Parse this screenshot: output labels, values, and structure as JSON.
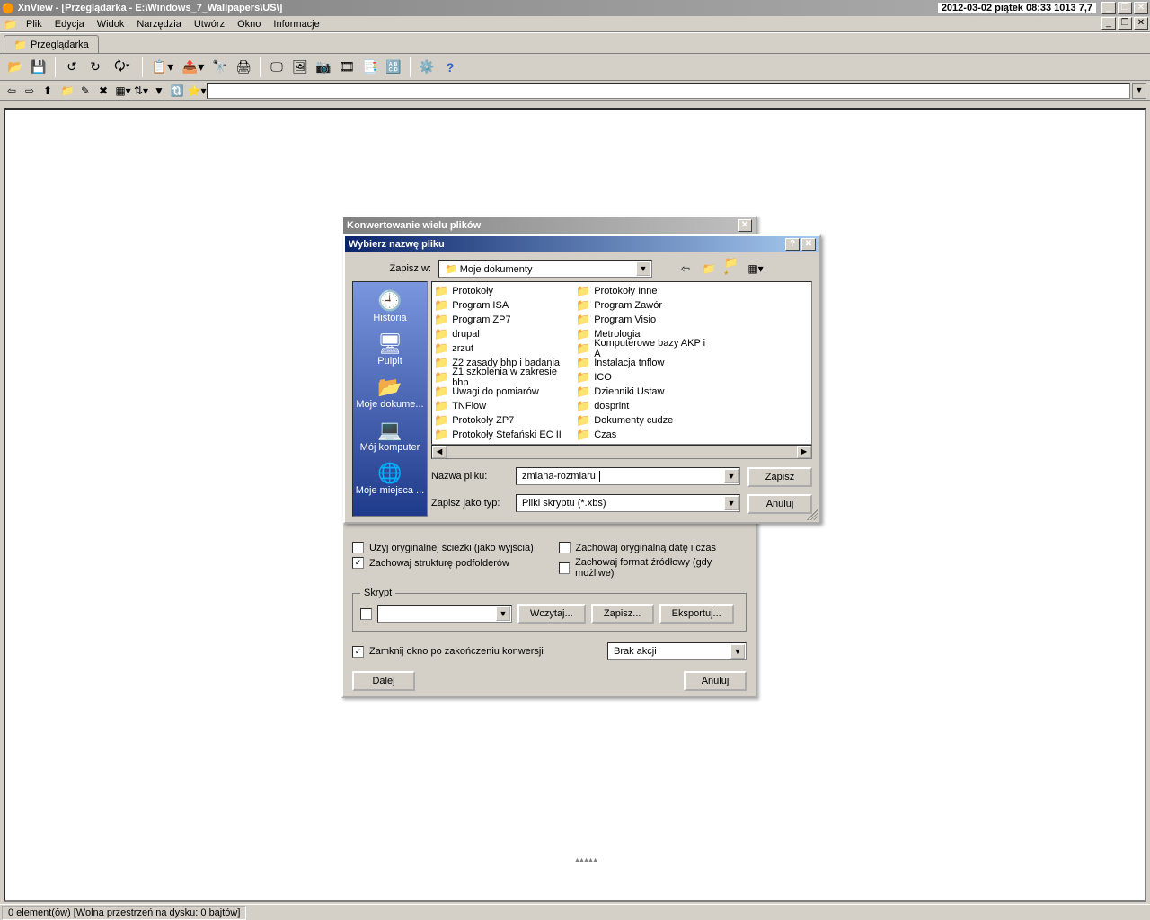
{
  "os_titlebar": {
    "app": "XnView",
    "title": "- [Przeglądarka - E:\\Windows_7_Wallpapers\\US\\]",
    "info": "2012-03-02 piątek 08:33  1013  7,7"
  },
  "menu": [
    "Plik",
    "Edycja",
    "Widok",
    "Narzędzia",
    "Utwórz",
    "Okno",
    "Informacje"
  ],
  "tab": {
    "label": "Przeglądarka"
  },
  "statusbar": {
    "cell1": "0 element(ów) [Wolna przestrzeń na dysku: 0 bajtów]"
  },
  "batch": {
    "title": "Konwertowanie wielu plików",
    "opts": {
      "use_orig": "Użyj oryginalnej ścieżki (jako wyjścia)",
      "keep_sub": "Zachowaj strukturę podfolderów",
      "keep_date": "Zachowaj oryginalną datę i czas",
      "keep_fmt": "Zachowaj format źródłowy (gdy możliwe)"
    },
    "script_group": "Skrypt",
    "btn_load": "Wczytaj...",
    "btn_save": "Zapisz...",
    "btn_export": "Eksportuj...",
    "close_after": "Zamknij okno po zakończeniu konwersji",
    "action_select": "Brak akcji",
    "btn_next": "Dalej",
    "btn_cancel": "Anuluj"
  },
  "filedlg": {
    "title": "Wybierz nazwę pliku",
    "save_in": "Zapisz w:",
    "current_folder": "Moje dokumenty",
    "places": [
      "Historia",
      "Pulpit",
      "Moje dokume...",
      "Mój komputer",
      "Moje miejsca ..."
    ],
    "folders_col1": [
      "Protokoły",
      "Program ISA",
      "Program ZP7",
      "drupal",
      "zrzut",
      "Z2 zasady bhp i badania",
      "Z1 szkolenia w zakresie bhp",
      "Uwagi do pomiarów",
      "TNFlow",
      "Protokoły ZP7",
      "Protokoły Stefański EC II"
    ],
    "folders_col2": [
      "Protokoły Inne",
      "Program Zawór",
      "Program Visio",
      "Metrologia",
      "Komputerowe bazy AKP i A",
      "Instalacja tnflow",
      "ICO",
      "Dzienniki Ustaw",
      "dosprint",
      "Dokumenty cudze",
      "Czas"
    ],
    "filename_label": "Nazwa pliku:",
    "filename_value": "zmiana-rozmiaru",
    "filetype_label": "Zapisz jako typ:",
    "filetype_value": "Pliki skryptu (*.xbs)",
    "btn_save": "Zapisz",
    "btn_cancel": "Anuluj"
  }
}
